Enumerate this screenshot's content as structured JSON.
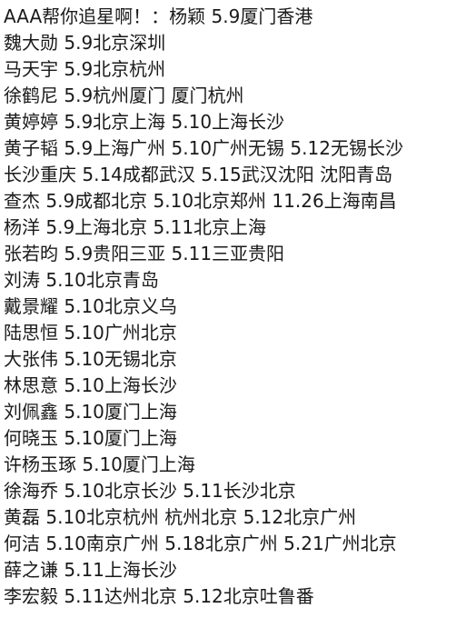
{
  "document": {
    "lines": [
      "AAA帮你追星啊！：杨颖 5.9厦门香港",
      "魏大勋 5.9北京深圳",
      "马天宇 5.9北京杭州",
      "徐鹤尼 5.9杭州厦门 厦门杭州",
      "黄婷婷 5.9北京上海 5.10上海长沙",
      "黄子韬 5.9上海广州 5.10广州无锡 5.12无锡长沙",
      "长沙重庆 5.14成都武汉 5.15武汉沈阳 沈阳青岛",
      "查杰 5.9成都北京 5.10北京郑州 11.26上海南昌",
      "杨洋 5.9上海北京 5.11北京上海",
      "张若昀 5.9贵阳三亚 5.11三亚贵阳",
      "刘涛 5.10北京青岛",
      "戴景耀 5.10北京义乌",
      "陆思恒 5.10广州北京",
      "大张伟 5.10无锡北京",
      "林思意 5.10上海长沙",
      "刘佩鑫 5.10厦门上海",
      "何晓玉 5.10厦门上海",
      "许杨玉琢 5.10厦门上海",
      "徐海乔 5.10北京长沙 5.11长沙北京",
      "黄磊 5.10北京杭州 杭州北京 5.12北京广州",
      "何洁 5.10南京广州 5.18北京广州 5.21广州北京",
      "薛之谦 5.11上海长沙",
      "李宏毅 5.11达州北京 5.12北京吐鲁番"
    ]
  }
}
